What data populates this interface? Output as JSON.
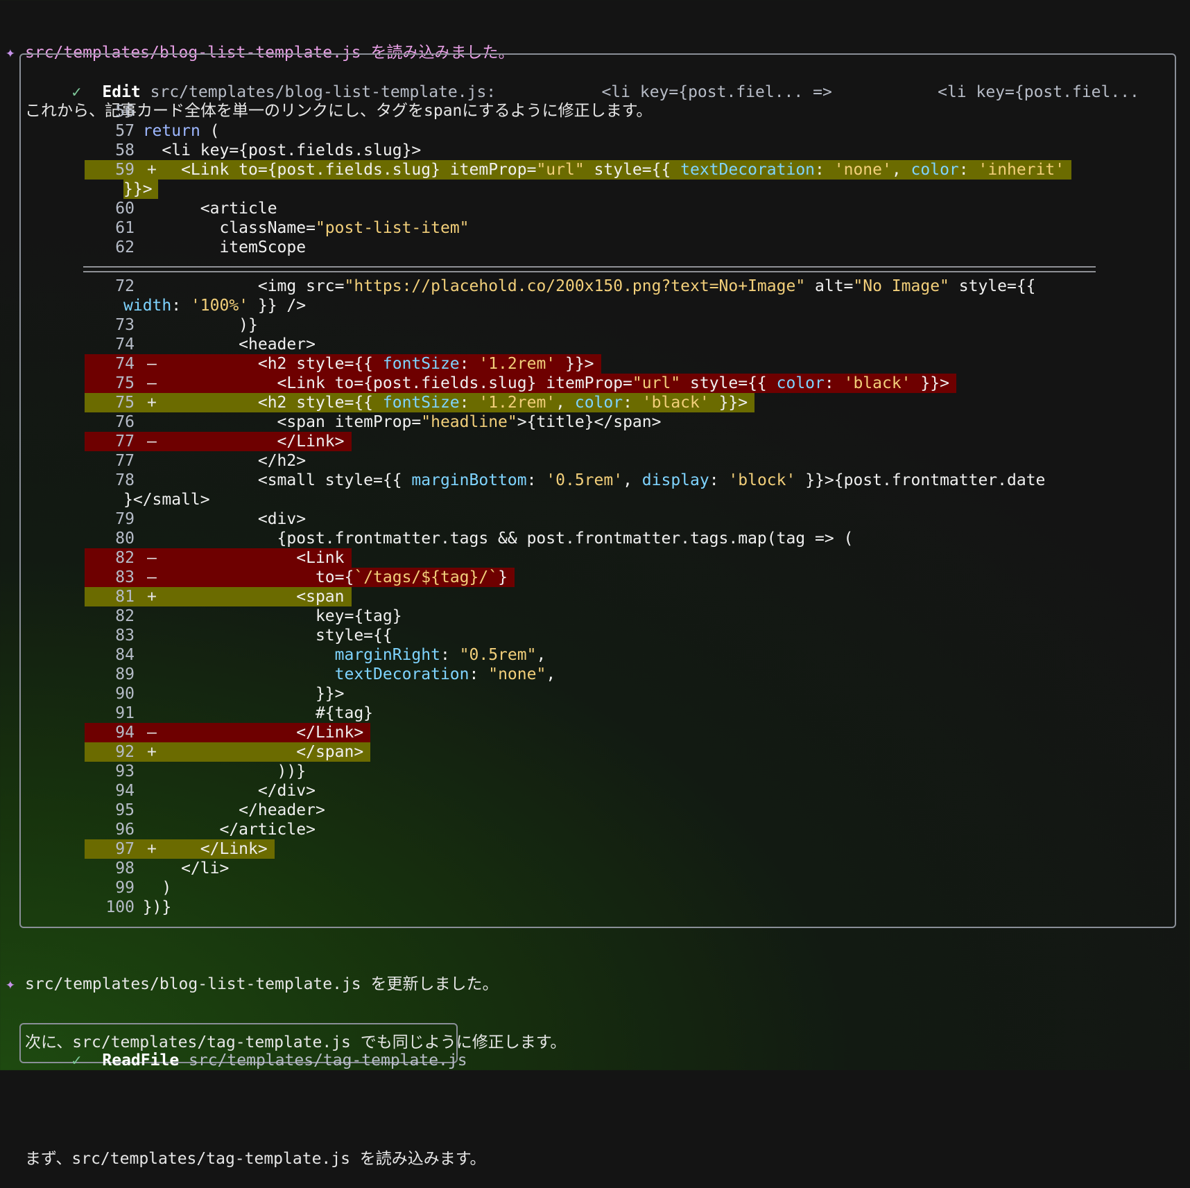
{
  "msg1": {
    "line1": "src/templates/blog-list-template.js を読み込みました。",
    "line2": "これから、記事カード全体を単一のリンクにし、タグをspanにするように修正します。"
  },
  "edit": {
    "tool": "Edit",
    "summary": "src/templates/blog-list-template.js:           <li key={post.fiel... =>           <li key={post.fiel...",
    "hunk1": [
      {
        "n": "56",
        "t": " ",
        "c": ""
      },
      {
        "n": "57",
        "t": " ",
        "c": "  return ("
      },
      {
        "n": "58",
        "t": " ",
        "c": "    <li key={post.fields.slug}>"
      },
      {
        "n": "59",
        "t": "+",
        "c": "      <Link to={post.fields.slug} itemProp=\"url\" style={{ textDecoration: 'none', color: 'inherit'"
      },
      {
        "n": "",
        "t": "+c",
        "c": "}}>"
      },
      {
        "n": "60",
        "t": " ",
        "c": "        <article"
      },
      {
        "n": "61",
        "t": " ",
        "c": "          className=\"post-list-item\""
      },
      {
        "n": "62",
        "t": " ",
        "c": "          itemScope"
      }
    ],
    "hunk2": [
      {
        "n": "72",
        "t": " ",
        "c": "              <img src=\"https://placehold.co/200x150.png?text=No+Image\" alt=\"No Image\" style={{"
      },
      {
        "n": "",
        "t": " ",
        "c": "width: '100%' }} />"
      },
      {
        "n": "73",
        "t": " ",
        "c": "            )}"
      },
      {
        "n": "74",
        "t": " ",
        "c": "            <header>"
      },
      {
        "n": "74",
        "t": "-",
        "c": "              <h2 style={{ fontSize: '1.2rem' }}>"
      },
      {
        "n": "75",
        "t": "-",
        "c": "                <Link to={post.fields.slug} itemProp=\"url\" style={{ color: 'black' }}>"
      },
      {
        "n": "75",
        "t": "+",
        "c": "              <h2 style={{ fontSize: '1.2rem', color: 'black' }}>"
      },
      {
        "n": "76",
        "t": " ",
        "c": "                <span itemProp=\"headline\">{title}</span>"
      },
      {
        "n": "77",
        "t": "-",
        "c": "                </Link>"
      },
      {
        "n": "77",
        "t": " ",
        "c": "              </h2>"
      },
      {
        "n": "78",
        "t": " ",
        "c": "              <small style={{ marginBottom: '0.5rem', display: 'block' }}>{post.frontmatter.date"
      },
      {
        "n": "",
        "t": " ",
        "c": "}</small>"
      },
      {
        "n": "79",
        "t": " ",
        "c": "              <div>"
      },
      {
        "n": "80",
        "t": " ",
        "c": "                {post.frontmatter.tags && post.frontmatter.tags.map(tag => ("
      },
      {
        "n": "82",
        "t": "-",
        "c": "                  <Link"
      },
      {
        "n": "83",
        "t": "-",
        "c": "                    to={`/tags/${tag}/`}"
      },
      {
        "n": "81",
        "t": "+",
        "c": "                  <span"
      },
      {
        "n": "82",
        "t": " ",
        "c": "                    key={tag}"
      },
      {
        "n": "83",
        "t": " ",
        "c": "                    style={{"
      },
      {
        "n": "84",
        "t": " ",
        "c": "                      marginRight: \"0.5rem\","
      },
      {
        "n": "89",
        "t": " ",
        "c": "                      textDecoration: \"none\","
      },
      {
        "n": "90",
        "t": " ",
        "c": "                    }}>"
      },
      {
        "n": "91",
        "t": " ",
        "c": "                    #{tag}"
      },
      {
        "n": "94",
        "t": "-",
        "c": "                  </Link>"
      },
      {
        "n": "92",
        "t": "+",
        "c": "                  </span>"
      },
      {
        "n": "93",
        "t": " ",
        "c": "                ))}"
      },
      {
        "n": "94",
        "t": " ",
        "c": "              </div>"
      },
      {
        "n": "95",
        "t": " ",
        "c": "            </header>"
      },
      {
        "n": "96",
        "t": " ",
        "c": "          </article>"
      },
      {
        "n": "97",
        "t": "+",
        "c": "        </Link>"
      },
      {
        "n": "98",
        "t": " ",
        "c": "      </li>"
      },
      {
        "n": "99",
        "t": " ",
        "c": "    )"
      },
      {
        "n": "100",
        "t": " ",
        "c": "  })}"
      }
    ]
  },
  "msg2": {
    "line1": "src/templates/blog-list-template.js を更新しました。",
    "line2": "次に、src/templates/tag-template.js でも同じように修正します。",
    "line3": "まず、src/templates/tag-template.js を読み込みます。"
  },
  "readfile": {
    "tool": "ReadFile",
    "path": "src/templates/tag-template.js"
  },
  "colors": {
    "added_bg": "#6b6b00",
    "removed_bg": "#6e0000",
    "accent": "#c792ea"
  }
}
